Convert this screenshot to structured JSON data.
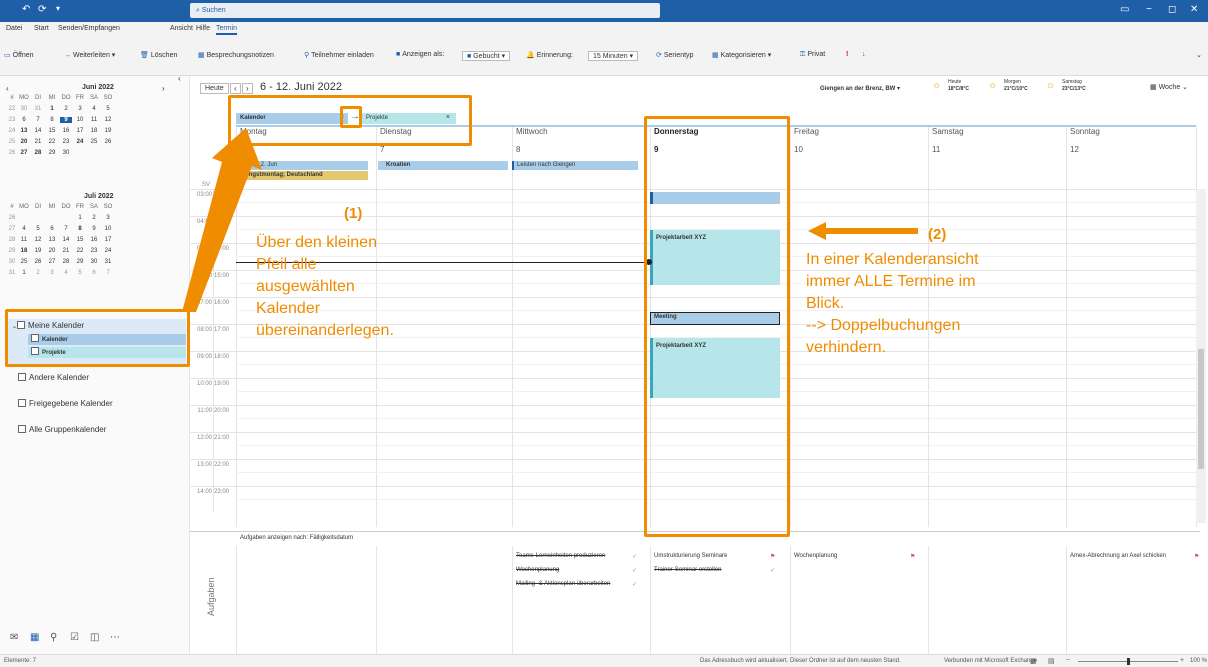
{
  "titlebar": {
    "search_placeholder": "Suchen"
  },
  "menu": [
    "Datei",
    "Start",
    "Senden/Empfangen",
    "Ansicht",
    "Hilfe",
    "Termin"
  ],
  "ribbon": {
    "open": "Öffnen",
    "forward": "Weiterleiten",
    "delete": "Löschen",
    "notes": "Besprechungsnotizen",
    "invite": "Teilnehmer einladen",
    "show_as_label": "Anzeigen als:",
    "show_as_value": "Gebucht",
    "reminder_label": "Erinnerung:",
    "reminder_value": "15 Minuten",
    "series": "Serientyp",
    "categorize": "Kategorisieren",
    "private": "Privat"
  },
  "minical": {
    "june_title": "Juni 2022",
    "july_title": "Juli 2022",
    "weekday_header": [
      "#",
      "MO",
      "DI",
      "MI",
      "DO",
      "FR",
      "SA",
      "SO"
    ],
    "june_rows": [
      [
        "22",
        "30",
        "31",
        "1",
        "2",
        "3",
        "4",
        "5"
      ],
      [
        "23",
        "6",
        "7",
        "8",
        "9",
        "10",
        "11",
        "12"
      ],
      [
        "24",
        "13",
        "14",
        "15",
        "16",
        "17",
        "18",
        "19"
      ],
      [
        "25",
        "20",
        "21",
        "22",
        "23",
        "24",
        "25",
        "26"
      ],
      [
        "26",
        "27",
        "28",
        "29",
        "30",
        "",
        "",
        ""
      ]
    ],
    "july_rows": [
      [
        "26",
        "",
        "",
        "",
        "",
        "1",
        "2",
        "3"
      ],
      [
        "27",
        "4",
        "5",
        "6",
        "7",
        "8",
        "9",
        "10"
      ],
      [
        "28",
        "11",
        "12",
        "13",
        "14",
        "15",
        "16",
        "17"
      ],
      [
        "29",
        "18",
        "19",
        "20",
        "21",
        "22",
        "23",
        "24"
      ],
      [
        "30",
        "25",
        "26",
        "27",
        "28",
        "29",
        "30",
        "31"
      ],
      [
        "31",
        "1",
        "2",
        "3",
        "4",
        "5",
        "6",
        "7"
      ]
    ]
  },
  "calendars": {
    "group": "Meine Kalender",
    "items": [
      "Kalender",
      "Projekte"
    ],
    "other": [
      "Andere Kalender",
      "Freigegebene Kalender",
      "Alle Gruppenkalender"
    ]
  },
  "nav": {
    "today": "Heute",
    "range": "6 - 12. Juni 2022",
    "location": "Giengen an der Brenz, BW",
    "weather": [
      {
        "label": "Heute",
        "temp": "18°C/8°C"
      },
      {
        "label": "Morgen",
        "temp": "21°C/10°C"
      },
      {
        "label": "Samstag",
        "temp": "23°C/13°C"
      }
    ],
    "view": "Woche"
  },
  "tabs": {
    "cal1": "Kalender",
    "cal2": "Projekte"
  },
  "days": [
    {
      "name": "Montag",
      "num": "6"
    },
    {
      "name": "Dienstag",
      "num": "7"
    },
    {
      "name": "Mittwoch",
      "num": "8"
    },
    {
      "name": "Donnerstag",
      "num": "9"
    },
    {
      "name": "Freitag",
      "num": "10"
    },
    {
      "name": "Samstag",
      "num": "11"
    },
    {
      "name": "Sonntag",
      "num": "12"
    }
  ],
  "allday": {
    "mon1": "← Von 2. Jun",
    "mon2": "Pfingstmontag; Deutschland",
    "tue": "Kroatien",
    "wed": "Leisten nach Giengen"
  },
  "times": [
    [
      "03:00",
      "12:00"
    ],
    [
      "04:00",
      "13:00"
    ],
    [
      "05:00",
      "14:00"
    ],
    [
      "06:00",
      "15:00"
    ],
    [
      "07:00",
      "16:00"
    ],
    [
      "08:00",
      "17:00"
    ],
    [
      "09:00",
      "18:00"
    ],
    [
      "10:00",
      "19:00"
    ],
    [
      "11:00",
      "20:00"
    ],
    [
      "12:00",
      "21:00"
    ],
    [
      "13:00",
      "22:00"
    ],
    [
      "14:00",
      "23:00"
    ]
  ],
  "timezone_labels": [
    "SV"
  ],
  "events": {
    "proj1": "Projektarbeit XYZ",
    "meeting": "Meeting",
    "proj2": "Projektarbeit XYZ"
  },
  "tasks": {
    "header": "Aufgaben anzeigen nach: Fälligkeitsdatum",
    "side_label": "Aufgaben",
    "wed": [
      "Teams-Lerneinheiten produzieren",
      "Wochenplanung",
      "Mailing- & Aktionsplan überarbeiten"
    ],
    "thu": [
      "Umstrukturierung Seminare",
      "Trainer-Seminar erstellen"
    ],
    "fri": [
      "Wochenplanung"
    ],
    "sun": [
      "Amex-Abrechnung an Axel schicken"
    ]
  },
  "annotations": {
    "num1": "(1)",
    "text1": "Über den kleinen\nPfeil alle\nausgewählten\nKalender\nübereinanderlegen.",
    "num2": "(2)",
    "text2": "In einer Kalenderansicht\nimmer ALLE Termine im\nBlick.\n--> Doppelbuchungen\nverhindern."
  },
  "status": {
    "items": "Elemente: 7",
    "sync": "Das Adressbuch wird aktualisiert.  Dieser Ordner ist auf dem neusten Stand.",
    "conn": "Verbunden mit Microsoft Exchange",
    "zoom": "100 %"
  },
  "colors": {
    "accent": "#1f5fa8",
    "orange": "#f08c00",
    "teal": "#b7e6ea",
    "blue_event": "#a9cde9"
  }
}
